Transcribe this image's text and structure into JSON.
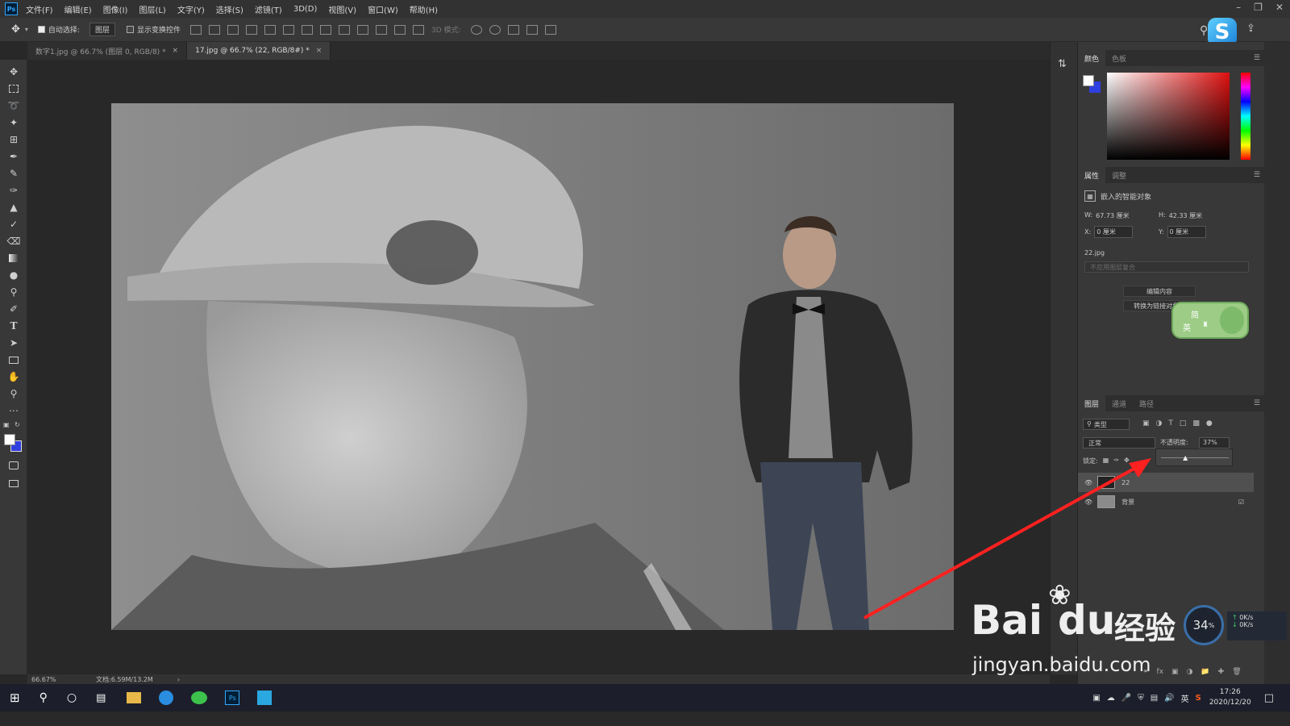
{
  "app": {
    "logo": "Ps"
  },
  "menu": [
    "文件(F)",
    "编辑(E)",
    "图像(I)",
    "图层(L)",
    "文字(Y)",
    "选择(S)",
    "滤镜(T)",
    "3D(D)",
    "视图(V)",
    "窗口(W)",
    "帮助(H)"
  ],
  "options": {
    "auto_select_label": "自动选择:",
    "auto_select_value": "图层",
    "show_transform_label": "显示变换控件",
    "mode_3d_label": "3D 模式:"
  },
  "tabs": [
    {
      "label": "数字1.jpg @ 66.7% (图层 0, RGB/8) *",
      "close": "×"
    },
    {
      "label": "17.jpg @ 66.7% (22, RGB/8#) *",
      "close": "×"
    }
  ],
  "color_panel": {
    "tabs": [
      "颜色",
      "色板"
    ]
  },
  "properties": {
    "tabs": [
      "属性",
      "调整"
    ],
    "type_label": "嵌入的智能对象",
    "w_label": "W:",
    "w_value": "67.73 厘米",
    "h_label": "H:",
    "h_value": "42.33 厘米",
    "x_label": "X:",
    "x_value": "0 厘米",
    "y_label": "Y:",
    "y_value": "0 厘米",
    "filename": "22.jpg",
    "layer_comp_placeholder": "不应用图层复合",
    "edit_contents_button": "编辑内容",
    "convert_linked_button": "转换为链接对象..."
  },
  "ime_badge": {
    "char1": "简",
    "char2": "英"
  },
  "layers": {
    "tabs": [
      "图层",
      "通道",
      "路径"
    ],
    "filter_label": "类型",
    "blend_mode": "正常",
    "opacity_label": "不透明度:",
    "opacity_value": "37%",
    "opacity_fraction": 0.37,
    "lock_label": "锁定:",
    "items": [
      {
        "name": "22",
        "selected": true,
        "visible": true
      },
      {
        "name": "背景",
        "selected": false,
        "visible": true,
        "locked": true
      }
    ]
  },
  "status": {
    "zoom": "66.67%",
    "doc_size": "文档:6.59M/13.2M"
  },
  "net_monitor": {
    "percent": "34",
    "percent_sign": "%",
    "up": "0K/s",
    "down": "0K/s"
  },
  "taskbar": {
    "time": "17:26",
    "date": "2020/12/20",
    "lang": "英"
  },
  "watermark": {
    "brand": "Bai",
    "brand_du": "du",
    "jingyan": "经验",
    "url": "jingyan.baidu.com"
  },
  "colors": {
    "accent": "#31a8ff",
    "arrow": "#ff2020",
    "panel_bg": "#383838",
    "canvas_bg": "#282828"
  }
}
